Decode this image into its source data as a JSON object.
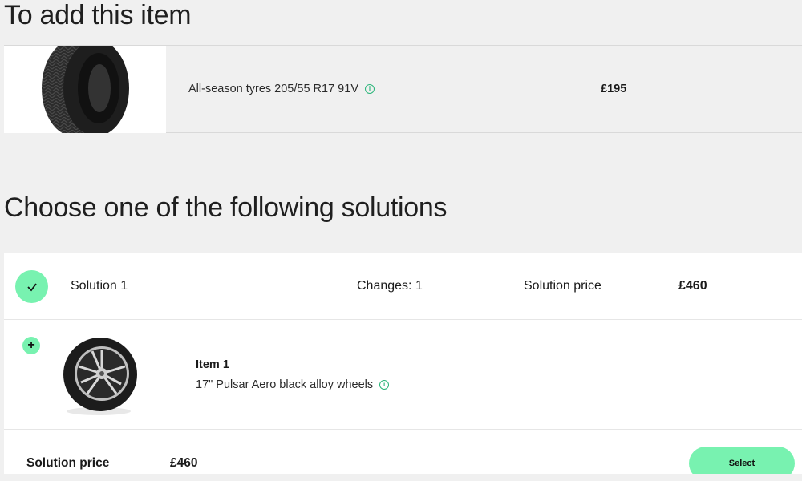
{
  "add_section": {
    "heading": "To add this item",
    "item": {
      "name": "All-season tyres 205/55 R17 91V",
      "price": "£195",
      "info_icon": "info-icon"
    }
  },
  "solutions_section": {
    "heading": "Choose one of the following solutions",
    "solutions": [
      {
        "title": "Solution 1",
        "changes": "Changes: 1",
        "price_label": "Solution price",
        "price": "£460",
        "selected": true,
        "items": [
          {
            "title": "Item 1",
            "description": "17\" Pulsar Aero black alloy wheels",
            "add_icon": "plus-icon",
            "info_icon": "info-icon"
          }
        ],
        "footer": {
          "price_label": "Solution price",
          "price": "£460",
          "select_label": "Select"
        }
      }
    ]
  },
  "colors": {
    "accent": "#78f2b0",
    "info": "#2bb57a",
    "background": "#f0f0f0"
  }
}
